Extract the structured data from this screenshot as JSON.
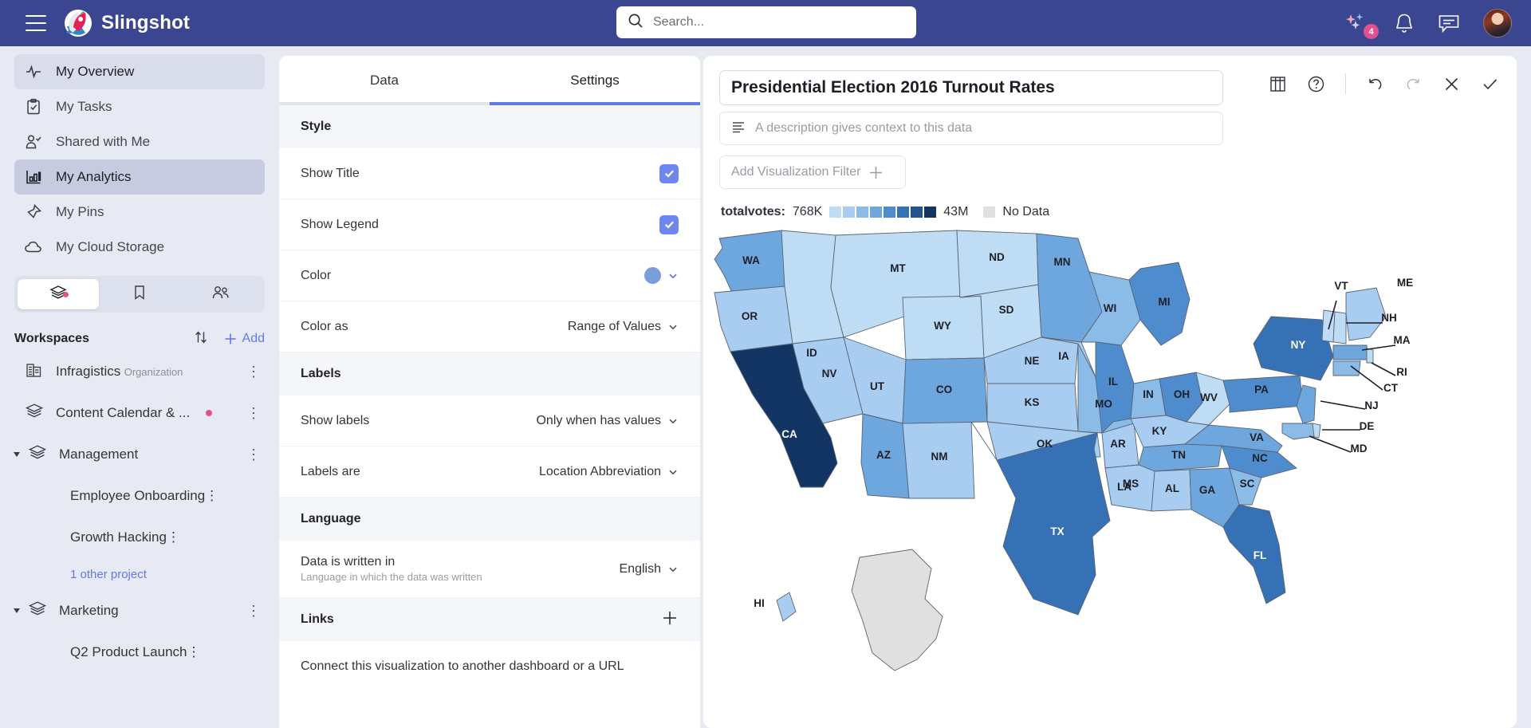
{
  "topbar": {
    "menu_icon": "hamburger-icon",
    "brand": "Slingshot",
    "search_placeholder": "Search...",
    "search_icon": "search-icon",
    "ai_icon": "sparkles-icon",
    "ai_badge": "4",
    "bell_icon": "bell-icon",
    "chat_icon": "chat-icon",
    "avatar": "user-avatar"
  },
  "sidebar": {
    "nav": [
      {
        "label": "My Overview",
        "icon": "pulse-icon",
        "state": "hover"
      },
      {
        "label": "My Tasks",
        "icon": "clipboard-check-icon",
        "state": ""
      },
      {
        "label": "Shared with Me",
        "icon": "person-check-icon",
        "state": ""
      },
      {
        "label": "My Analytics",
        "icon": "bar-chart-icon",
        "state": "selected"
      },
      {
        "label": "My Pins",
        "icon": "pin-icon",
        "state": ""
      },
      {
        "label": "My Cloud Storage",
        "icon": "cloud-icon",
        "state": ""
      }
    ],
    "segments": [
      {
        "icon": "layers-icon",
        "active": true,
        "dot": true
      },
      {
        "icon": "bookmark-icon",
        "active": false,
        "dot": false
      },
      {
        "icon": "people-icon",
        "active": false,
        "dot": false
      }
    ],
    "workspaces_title": "Workspaces",
    "sort_icon": "sort-arrows-icon",
    "add_label": "Add",
    "add_icon": "plus-icon",
    "items": [
      {
        "name": "Infragistics",
        "sub": "Organization",
        "icon": "building-icon",
        "kebab": true,
        "dot": false,
        "expandable": false
      },
      {
        "name": "Content Calendar & ...",
        "sub": "",
        "icon": "layers-icon",
        "kebab": true,
        "dot": true,
        "expandable": false
      },
      {
        "name": "Management",
        "sub": "",
        "icon": "layers-icon",
        "kebab": true,
        "dot": false,
        "expandable": true
      }
    ],
    "management_projects": [
      "Employee Onboarding",
      "Growth Hacking"
    ],
    "other_projects_label": "1 other project",
    "marketing": {
      "name": "Marketing",
      "icon": "layers-icon",
      "expandable": true
    },
    "marketing_projects": [
      "Q2 Product Launch"
    ]
  },
  "settings": {
    "tabs": [
      {
        "label": "Data",
        "active": false
      },
      {
        "label": "Settings",
        "active": true
      }
    ],
    "sections": {
      "style": "Style",
      "labels": "Labels",
      "language": "Language",
      "links": "Links"
    },
    "rows": {
      "show_title": {
        "label": "Show Title",
        "checked": true
      },
      "show_legend": {
        "label": "Show Legend",
        "checked": true
      },
      "color": {
        "label": "Color",
        "swatch": "#7a9ddb"
      },
      "color_as": {
        "label": "Color as",
        "value": "Range of Values"
      },
      "show_labels": {
        "label": "Show labels",
        "value": "Only when has values"
      },
      "labels_are": {
        "label": "Labels are",
        "value": "Location Abbreviation"
      },
      "data_written_in": {
        "label": "Data is written in",
        "sub": "Language in which the data was written",
        "value": "English"
      }
    },
    "links_hint": "Connect this visualization to another dashboard or a URL",
    "links_add_icon": "plus-icon"
  },
  "viz": {
    "title": "Presidential Election 2016 Turnout Rates",
    "description_placeholder": "A description gives context to this data",
    "description_icon": "text-lines-icon",
    "filter_label": "Add Visualization Filter",
    "filter_icon": "plus-icon",
    "tools": [
      {
        "name": "table-icon"
      },
      {
        "name": "help-icon"
      },
      {
        "name": "undo-icon"
      },
      {
        "name": "redo-icon"
      },
      {
        "name": "close-icon"
      },
      {
        "name": "confirm-icon"
      }
    ]
  },
  "chart_data": {
    "type": "heatmap",
    "title": "Presidential Election 2016 Turnout Rates",
    "legend": {
      "key": "totalvotes:",
      "min_label": "768K",
      "max_label": "43M",
      "no_data_label": "No Data",
      "ramp": [
        "#bfdcf5",
        "#a8cdf0",
        "#8bbce8",
        "#6ea6de",
        "#4f8cce",
        "#3671b5",
        "#24548f",
        "#123564"
      ],
      "no_data_color": "#e0e0e0"
    },
    "states": [
      {
        "abbr": "WA",
        "bin": 3
      },
      {
        "abbr": "OR",
        "bin": 1
      },
      {
        "abbr": "CA",
        "bin": 7
      },
      {
        "abbr": "NV",
        "bin": 1
      },
      {
        "abbr": "ID",
        "bin": 0
      },
      {
        "abbr": "MT",
        "bin": 0
      },
      {
        "abbr": "WY",
        "bin": 0
      },
      {
        "abbr": "UT",
        "bin": 1
      },
      {
        "abbr": "AZ",
        "bin": 3
      },
      {
        "abbr": "NM",
        "bin": 1
      },
      {
        "abbr": "CO",
        "bin": 3
      },
      {
        "abbr": "ND",
        "bin": 0
      },
      {
        "abbr": "SD",
        "bin": 0
      },
      {
        "abbr": "NE",
        "bin": 1
      },
      {
        "abbr": "KS",
        "bin": 1
      },
      {
        "abbr": "OK",
        "bin": 1
      },
      {
        "abbr": "TX",
        "bin": 5
      },
      {
        "abbr": "MN",
        "bin": 3
      },
      {
        "abbr": "IA",
        "bin": 1
      },
      {
        "abbr": "MO",
        "bin": 2
      },
      {
        "abbr": "AR",
        "bin": 1
      },
      {
        "abbr": "LA",
        "bin": 1
      },
      {
        "abbr": "WI",
        "bin": 2
      },
      {
        "abbr": "IL",
        "bin": 4
      },
      {
        "abbr": "MI",
        "bin": 4
      },
      {
        "abbr": "IN",
        "bin": 2
      },
      {
        "abbr": "OH",
        "bin": 4
      },
      {
        "abbr": "KY",
        "bin": 1
      },
      {
        "abbr": "TN",
        "bin": 3
      },
      {
        "abbr": "MS",
        "bin": 1
      },
      {
        "abbr": "AL",
        "bin": 1
      },
      {
        "abbr": "GA",
        "bin": 3
      },
      {
        "abbr": "FL",
        "bin": 5
      },
      {
        "abbr": "SC",
        "bin": 2
      },
      {
        "abbr": "NC",
        "bin": 4
      },
      {
        "abbr": "VA",
        "bin": 3
      },
      {
        "abbr": "WV",
        "bin": 0
      },
      {
        "abbr": "PA",
        "bin": 4
      },
      {
        "abbr": "NY",
        "bin": 5
      },
      {
        "abbr": "VT",
        "bin": 0
      },
      {
        "abbr": "NH",
        "bin": 0
      },
      {
        "abbr": "ME",
        "bin": 1
      },
      {
        "abbr": "MA",
        "bin": 3
      },
      {
        "abbr": "RI",
        "bin": 0
      },
      {
        "abbr": "CT",
        "bin": 2
      },
      {
        "abbr": "NJ",
        "bin": 3
      },
      {
        "abbr": "DE",
        "bin": 0
      },
      {
        "abbr": "MD",
        "bin": 2
      },
      {
        "abbr": "HI",
        "bin": 1
      },
      {
        "abbr": "AK",
        "bin": -1
      }
    ]
  }
}
